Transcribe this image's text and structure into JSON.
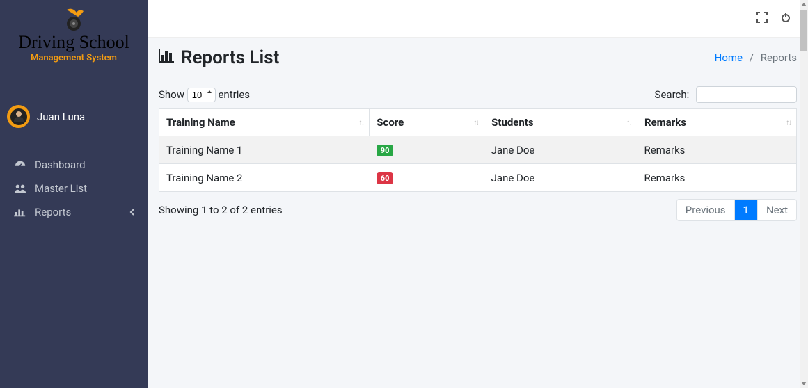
{
  "brand": {
    "title": "Driving School",
    "subtitle": "Management System"
  },
  "user": {
    "name": "Juan Luna"
  },
  "nav": {
    "dashboard": "Dashboard",
    "master_list": "Master List",
    "reports": "Reports"
  },
  "page": {
    "title": "Reports List"
  },
  "breadcrumb": {
    "home": "Home",
    "sep": "/",
    "current": "Reports"
  },
  "table": {
    "length_prefix": "Show",
    "length_value": "10",
    "length_suffix": "entries",
    "search_label": "Search:",
    "headers": {
      "training": "Training Name",
      "score": "Score",
      "students": "Students",
      "remarks": "Remarks"
    },
    "rows": [
      {
        "training": "Training Name 1",
        "score": "90",
        "score_class": "badge-green",
        "students": "Jane Doe",
        "remarks": "Remarks"
      },
      {
        "training": "Training Name 2",
        "score": "60",
        "score_class": "badge-red",
        "students": "Jane Doe",
        "remarks": "Remarks"
      }
    ],
    "info": "Showing 1 to 2 of 2 entries",
    "pagination": {
      "prev": "Previous",
      "page1": "1",
      "next": "Next"
    }
  }
}
